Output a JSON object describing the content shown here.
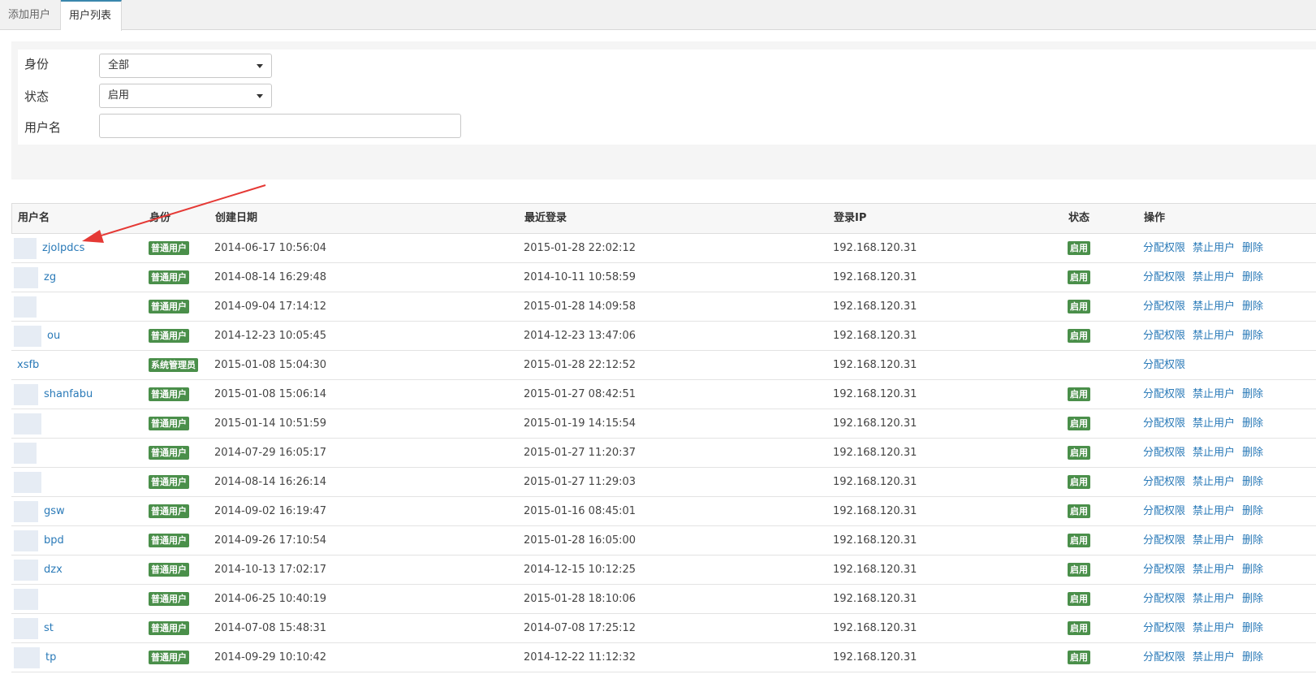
{
  "tabs": [
    {
      "label": "添加用户"
    },
    {
      "label": "用户列表"
    }
  ],
  "filters": {
    "role_label": "身份",
    "role_value": "全部",
    "status_label": "状态",
    "status_value": "启用",
    "username_label": "用户名",
    "username_value": ""
  },
  "table": {
    "headers": [
      "用户名",
      "身份",
      "创建日期",
      "最近登录",
      "登录IP",
      "状态",
      "操作"
    ],
    "actions": {
      "assign": "分配权限",
      "disable": "禁止用户",
      "delete": "删除"
    },
    "rows": [
      {
        "username": "zjolpdcs",
        "role": "普通用户",
        "created": "2014-06-17 10:56:04",
        "last_login": "2015-01-28 22:02:12",
        "ip": "192.168.120.31",
        "status": "启用",
        "full_actions": true
      },
      {
        "username": "zg",
        "role": "普通用户",
        "created": "2014-08-14 16:29:48",
        "last_login": "2014-10-11 10:58:59",
        "ip": "192.168.120.31",
        "status": "启用",
        "full_actions": true
      },
      {
        "username": "",
        "role": "普通用户",
        "created": "2014-09-04 17:14:12",
        "last_login": "2015-01-28 14:09:58",
        "ip": "192.168.120.31",
        "status": "启用",
        "full_actions": true
      },
      {
        "username": "ou",
        "role": "普通用户",
        "created": "2014-12-23 10:05:45",
        "last_login": "2014-12-23 13:47:06",
        "ip": "192.168.120.31",
        "status": "启用",
        "full_actions": true
      },
      {
        "username": "xsfb",
        "role": "系统管理员",
        "created": "2015-01-08 15:04:30",
        "last_login": "2015-01-28 22:12:52",
        "ip": "192.168.120.31",
        "status": "",
        "full_actions": false
      },
      {
        "username": "shanfabu",
        "role": "普通用户",
        "created": "2015-01-08 15:06:14",
        "last_login": "2015-01-27 08:42:51",
        "ip": "192.168.120.31",
        "status": "启用",
        "full_actions": true
      },
      {
        "username": "",
        "role": "普通用户",
        "created": "2015-01-14 10:51:59",
        "last_login": "2015-01-19 14:15:54",
        "ip": "192.168.120.31",
        "status": "启用",
        "full_actions": true
      },
      {
        "username": "",
        "role": "普通用户",
        "created": "2014-07-29 16:05:17",
        "last_login": "2015-01-27 11:20:37",
        "ip": "192.168.120.31",
        "status": "启用",
        "full_actions": true
      },
      {
        "username": "",
        "role": "普通用户",
        "created": "2014-08-14 16:26:14",
        "last_login": "2015-01-27 11:29:03",
        "ip": "192.168.120.31",
        "status": "启用",
        "full_actions": true
      },
      {
        "username": "gsw",
        "role": "普通用户",
        "created": "2014-09-02 16:19:47",
        "last_login": "2015-01-16 08:45:01",
        "ip": "192.168.120.31",
        "status": "启用",
        "full_actions": true
      },
      {
        "username": "bpd",
        "role": "普通用户",
        "created": "2014-09-26 17:10:54",
        "last_login": "2015-01-28 16:05:00",
        "ip": "192.168.120.31",
        "status": "启用",
        "full_actions": true
      },
      {
        "username": "dzx",
        "role": "普通用户",
        "created": "2014-10-13 17:02:17",
        "last_login": "2014-12-15 10:12:25",
        "ip": "192.168.120.31",
        "status": "启用",
        "full_actions": true
      },
      {
        "username": "",
        "role": "普通用户",
        "created": "2014-06-25 10:40:19",
        "last_login": "2015-01-28 18:10:06",
        "ip": "192.168.120.31",
        "status": "启用",
        "full_actions": true
      },
      {
        "username": "st",
        "role": "普通用户",
        "created": "2014-07-08 15:48:31",
        "last_login": "2014-07-08 17:25:12",
        "ip": "192.168.120.31",
        "status": "启用",
        "full_actions": true
      },
      {
        "username": "tp",
        "role": "普通用户",
        "created": "2014-09-29 10:10:42",
        "last_login": "2014-12-22 11:12:32",
        "ip": "192.168.120.31",
        "status": "启用",
        "full_actions": true
      }
    ]
  },
  "colors": {
    "accent": "#2a7ab8",
    "badge": "#4a8f4a",
    "annotation_arrow": "#e53935"
  }
}
